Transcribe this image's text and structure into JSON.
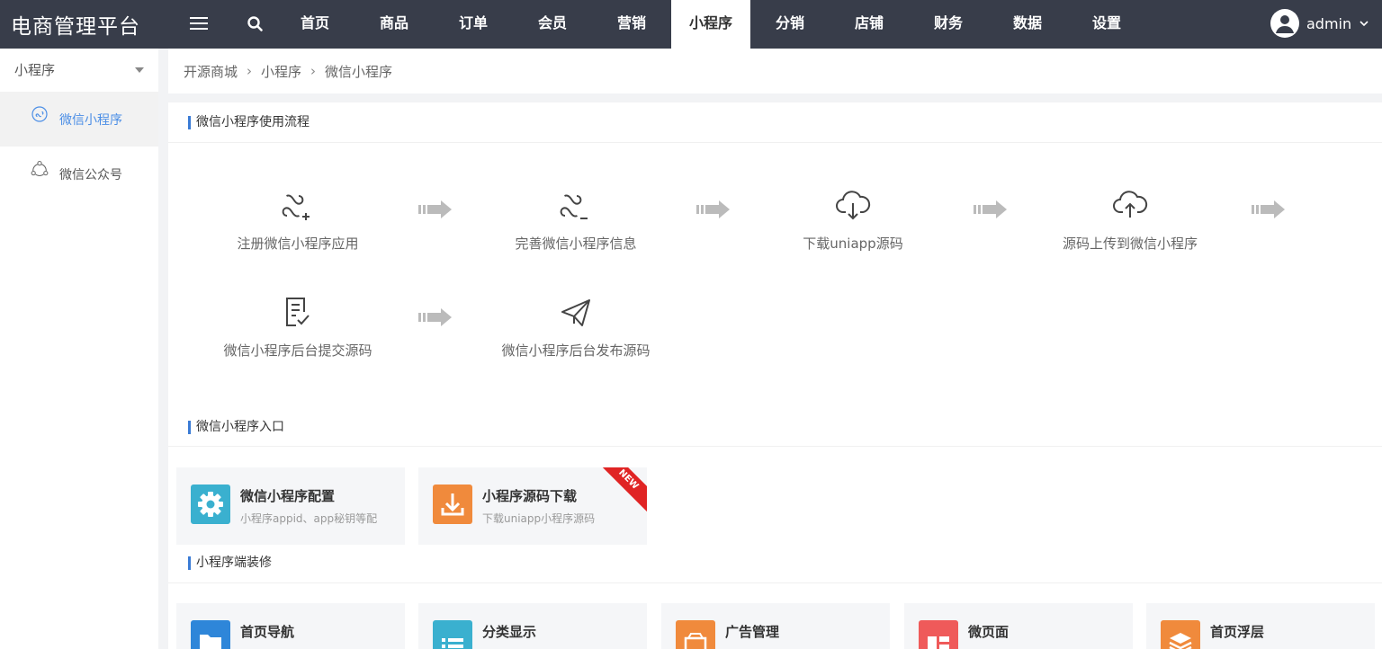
{
  "header": {
    "brand": "电商管理平台",
    "nav": [
      "首页",
      "商品",
      "订单",
      "会员",
      "营销",
      "小程序",
      "分销",
      "店铺",
      "财务",
      "数据",
      "设置"
    ],
    "active_nav": "小程序",
    "user": "admin"
  },
  "sidebar": {
    "title": "小程序",
    "items": [
      {
        "label": "微信小程序",
        "icon": "mini-program-icon",
        "active": true
      },
      {
        "label": "微信公众号",
        "icon": "official-account-icon",
        "active": false
      }
    ]
  },
  "breadcrumb": [
    "开源商城",
    "小程序",
    "微信小程序"
  ],
  "flow": {
    "title": "微信小程序使用流程",
    "steps": [
      {
        "label": "注册微信小程序应用",
        "icon": "mini-program-add-icon"
      },
      {
        "label": "完善微信小程序信息",
        "icon": "mini-program-edit-icon"
      },
      {
        "label": "下载uniapp源码",
        "icon": "cloud-download-icon"
      },
      {
        "label": "源码上传到微信小程序",
        "icon": "cloud-upload-icon"
      },
      {
        "label": "微信小程序后台提交源码",
        "icon": "document-check-icon"
      },
      {
        "label": "微信小程序后台发布源码",
        "icon": "paper-plane-icon"
      }
    ]
  },
  "entry": {
    "title": "微信小程序入口",
    "cards": [
      {
        "title": "微信小程序配置",
        "desc": "小程序appid、app秘钥等配",
        "icon": "gear-icon",
        "color": "#3ab0cf"
      },
      {
        "title": "小程序源码下载",
        "desc": "下载uniapp小程序源码",
        "icon": "download-icon",
        "color": "#f08a3c",
        "badge": "NEW"
      }
    ]
  },
  "decor": {
    "title": "小程序端装修",
    "cards": [
      {
        "title": "首页导航",
        "icon": "folder-icon",
        "color": "#2e86d9"
      },
      {
        "title": "分类显示",
        "icon": "list-icon",
        "color": "#3ab0cf"
      },
      {
        "title": "广告管理",
        "icon": "ad-icon",
        "color": "#f08a3c"
      },
      {
        "title": "微页面",
        "icon": "page-layout-icon",
        "color": "#ef5a5a"
      },
      {
        "title": "首页浮层",
        "icon": "layers-icon",
        "color": "#f08a3c"
      }
    ]
  }
}
